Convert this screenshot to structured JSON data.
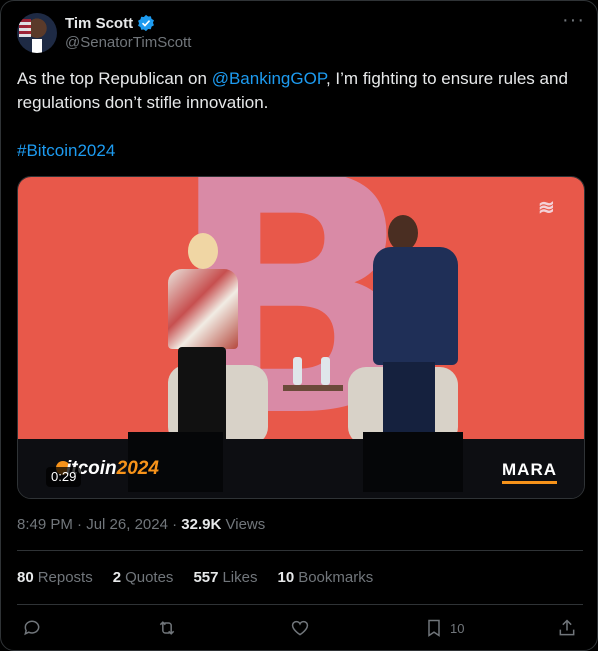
{
  "author": {
    "name": "Tim Scott",
    "handle": "@SenatorTimScott",
    "verified_color": "#1d9bf0"
  },
  "tweet": {
    "text_before": "As the top Republican on ",
    "mention": "@BankingGOP",
    "text_after": ", I’m fighting to ensure rules and regulations don’t stifle innovation.",
    "hashtag": "#Bitcoin2024"
  },
  "media": {
    "duration": "0:29",
    "brand_left_prefix": "",
    "brand_left_main": "itcoin",
    "brand_left_year": "2024",
    "brand_right": "MARA"
  },
  "meta": {
    "time": "8:49 PM",
    "date": "Jul 26, 2024",
    "views_count": "32.9K",
    "views_label": "Views"
  },
  "stats": {
    "reposts_count": "80",
    "reposts_label": "Reposts",
    "quotes_count": "2",
    "quotes_label": "Quotes",
    "likes_count": "557",
    "likes_label": "Likes",
    "bookmarks_count": "10",
    "bookmarks_label": "Bookmarks"
  },
  "actions": {
    "reply_icon": "reply-icon",
    "repost_icon": "repost-icon",
    "like_icon": "heart-icon",
    "bookmark_icon": "bookmark-icon",
    "bookmark_count": "10",
    "share_icon": "share-icon"
  },
  "colors": {
    "background": "#000000",
    "text": "#e7e9ea",
    "muted": "#71767b",
    "link": "#1d9bf0",
    "border": "#2f3336"
  }
}
